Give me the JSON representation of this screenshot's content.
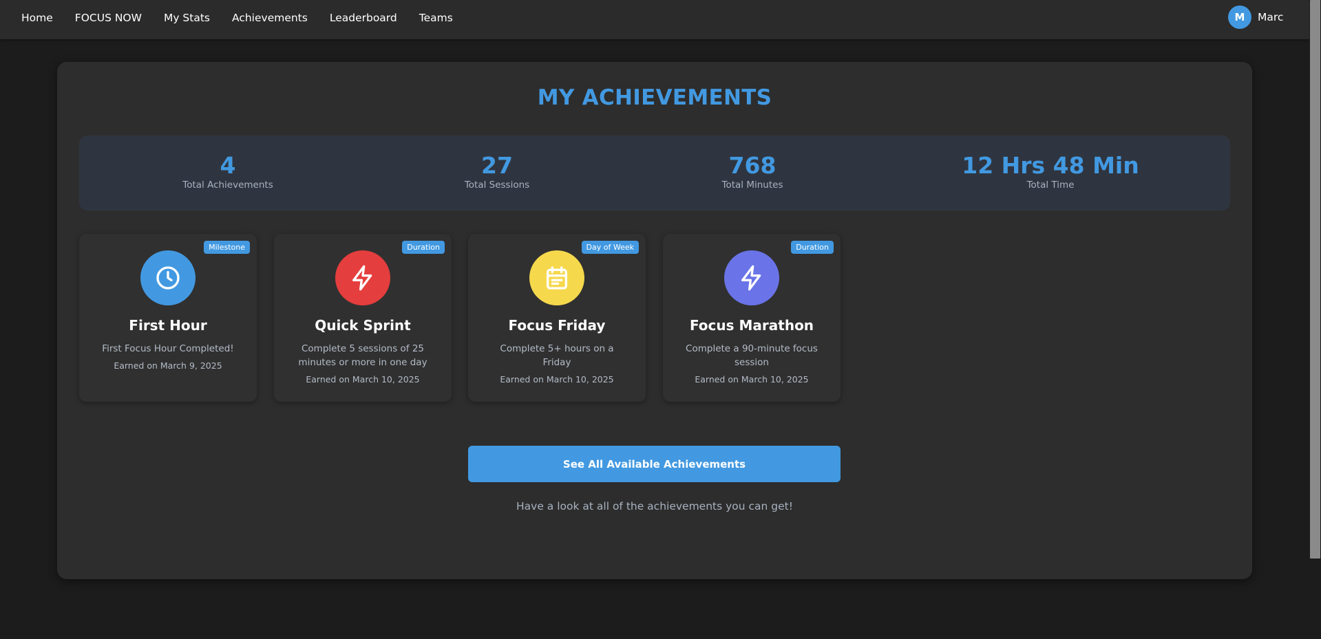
{
  "nav": {
    "links": [
      "Home",
      "FOCUS NOW",
      "My Stats",
      "Achievements",
      "Leaderboard",
      "Teams"
    ],
    "user": {
      "initial": "M",
      "name": "Marc"
    }
  },
  "page": {
    "title": "MY ACHIEVEMENTS"
  },
  "stats": [
    {
      "value": "4",
      "label": "Total Achievements"
    },
    {
      "value": "27",
      "label": "Total Sessions"
    },
    {
      "value": "768",
      "label": "Total Minutes"
    },
    {
      "value": "12 Hrs 48 Min",
      "label": "Total Time"
    }
  ],
  "achievements": [
    {
      "badge": "Milestone",
      "icon": "clock-icon",
      "color": "#4299e1",
      "title": "First Hour",
      "description": "First Focus Hour Completed!",
      "earned": "Earned on March 9, 2025"
    },
    {
      "badge": "Duration",
      "icon": "lightning-icon",
      "color": "#e53e3e",
      "title": "Quick Sprint",
      "description": "Complete 5 sessions of 25 minutes or more in one day",
      "earned": "Earned on March 10, 2025"
    },
    {
      "badge": "Day of Week",
      "icon": "calendar-icon",
      "color": "#f6d84c",
      "title": "Focus Friday",
      "description": "Complete 5+ hours on a Friday",
      "earned": "Earned on March 10, 2025"
    },
    {
      "badge": "Duration",
      "icon": "lightning-icon",
      "color": "#6a74e8",
      "title": "Focus Marathon",
      "description": "Complete a 90-minute focus session",
      "earned": "Earned on March 10, 2025"
    }
  ],
  "cta": {
    "label": "See All Available Achievements",
    "subtext": "Have a look at all of the achievements you can get!"
  }
}
